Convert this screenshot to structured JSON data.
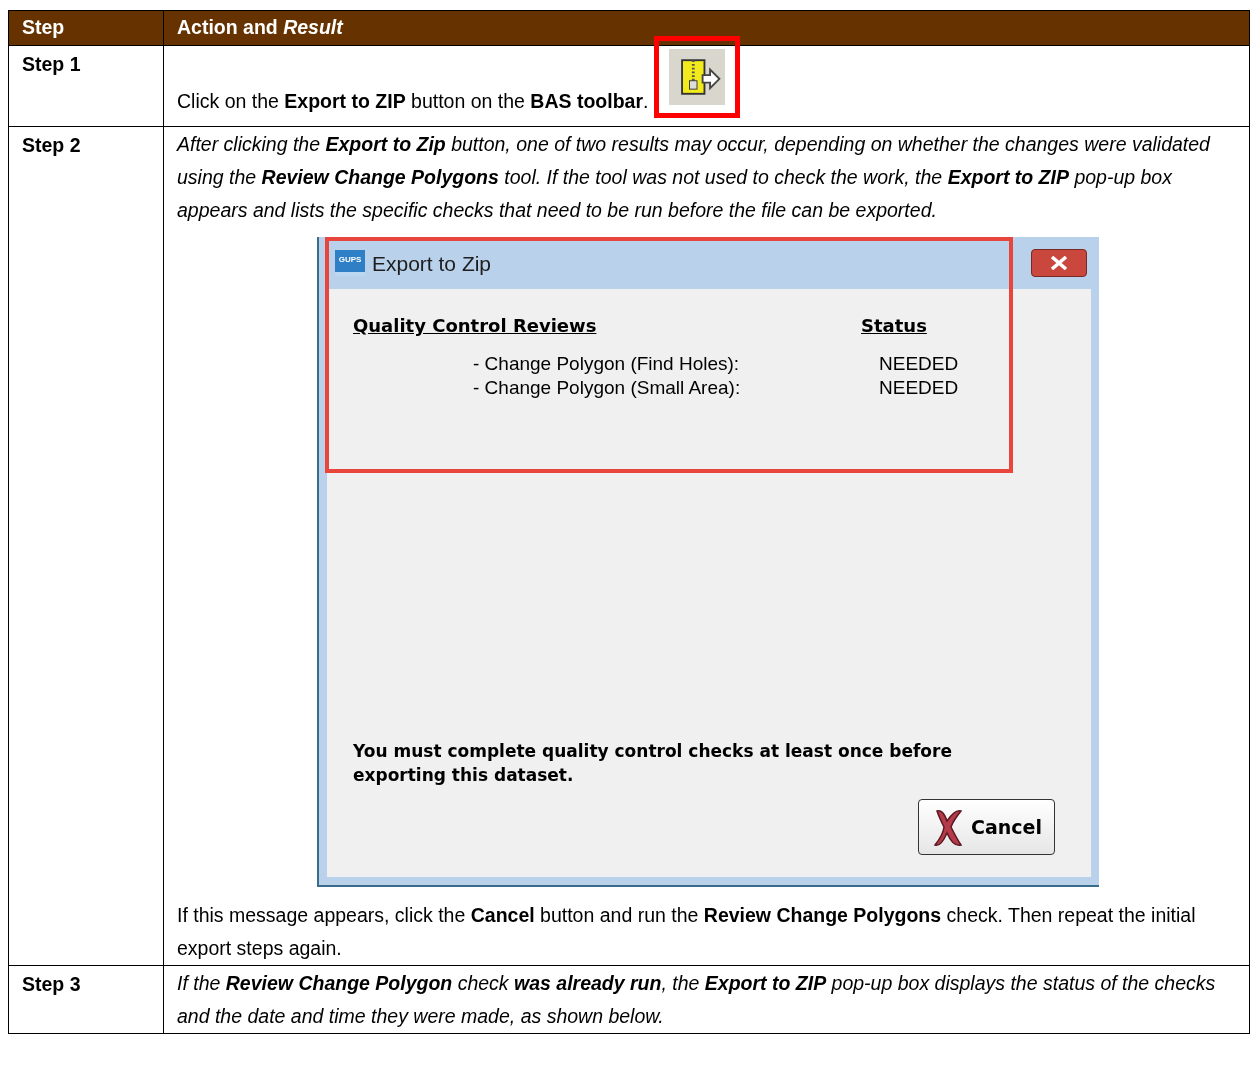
{
  "table": {
    "columns": [
      "Step",
      "Action and *Result*"
    ],
    "rows": [
      {
        "step": "Step 1",
        "blocks": [
          {
            "kind": "paragraph",
            "italic": false,
            "text": "Click on the **Export to ZIP** button on the **BAS toolbar**.",
            "toolbar_button": true
          }
        ]
      },
      {
        "step": "Step 2",
        "blocks": [
          {
            "kind": "paragraph",
            "italic": true,
            "text": "After clicking the **Export to Zip** button, one of two results may occur, depending on whether the changes were validated using the **Review Change Polygons** tool. If the tool was not used to check the work, the **Export to ZIP** pop-up box appears and lists the specific checks that need to be run before the file can be exported."
          },
          {
            "kind": "dialog",
            "title": "Export to Zip",
            "app_icon_text": "GUPS",
            "review_header": "Quality Control Reviews",
            "status_header": "Status",
            "checks": [
              {
                "label": "- Change Polygon (Find Holes):",
                "status": "NEEDED"
              },
              {
                "label": "- Change Polygon (Small Area):",
                "status": "NEEDED"
              }
            ],
            "message": "You must complete quality control checks at least once before exporting this dataset.",
            "button": "Cancel"
          },
          {
            "kind": "paragraph",
            "italic": false,
            "text": "If this message appears, click the **Cancel** button and run the **Review Change Polygons** check. Then repeat the initial export steps again."
          }
        ]
      },
      {
        "step": "Step 3",
        "blocks": [
          {
            "kind": "paragraph",
            "italic": true,
            "text": "If the **Review Change Polygon** check **was already run**, the **Export to ZIP** pop-up box displays the status of the checks and the date and time they were made, as shown below."
          }
        ]
      }
    ]
  }
}
